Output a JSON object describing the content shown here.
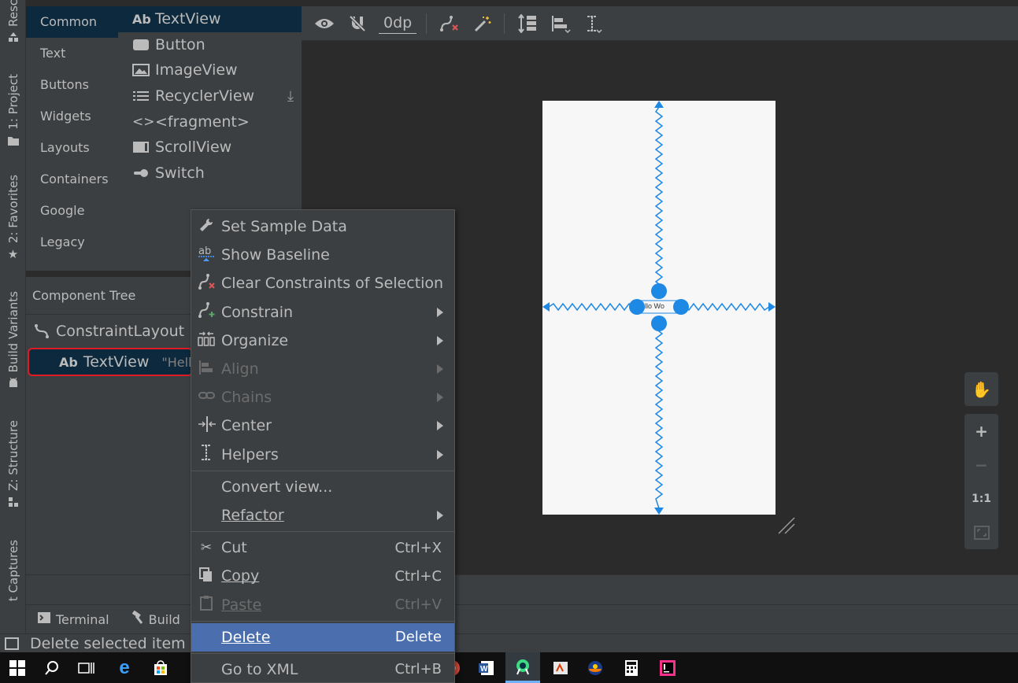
{
  "left_bar": {
    "tabs": [
      {
        "label": "Resc",
        "icon": "resource-manager-icon"
      },
      {
        "label": "1: Project",
        "icon": "folder-icon"
      },
      {
        "label": "2: Favorites",
        "icon": "star-icon"
      },
      {
        "label": "Build Variants",
        "icon": "android-icon"
      },
      {
        "label": "Z: Structure",
        "icon": "structure-icon"
      },
      {
        "label": "t Captures",
        "icon": "captures-icon"
      }
    ]
  },
  "palette": {
    "categories": [
      "Common",
      "Text",
      "Buttons",
      "Widgets",
      "Layouts",
      "Containers",
      "Google",
      "Legacy"
    ],
    "selected_category": "Common",
    "components": [
      {
        "label": "TextView",
        "icon": "Ab"
      },
      {
        "label": "Button",
        "icon": "button-icon"
      },
      {
        "label": "ImageView",
        "icon": "image-icon"
      },
      {
        "label": "RecyclerView",
        "icon": "list-icon"
      },
      {
        "label": "<fragment>",
        "icon": "code-icon"
      },
      {
        "label": "ScrollView",
        "icon": "scroll-icon"
      },
      {
        "label": "Switch",
        "icon": "switch-icon"
      }
    ]
  },
  "component_tree": {
    "title": "Component Tree",
    "root": "ConstraintLayout",
    "child": {
      "icon": "Ab",
      "label": "TextView",
      "text": "\"Hello"
    }
  },
  "toolbar": {
    "margin_value": "0dp"
  },
  "canvas": {
    "textview_text": "llo Wo"
  },
  "right_controls": {
    "zoom_fit_label": "1:1"
  },
  "bottom_tabs": [
    {
      "label": "Terminal",
      "icon": "terminal-icon"
    },
    {
      "label": "Build",
      "icon": "hammer-icon"
    }
  ],
  "status_bar": {
    "text": "Delete selected item"
  },
  "context_menu": {
    "items": [
      {
        "label": "Set Sample Data",
        "icon": "wrench-icon",
        "shortcut": "",
        "submenu": false,
        "disabled": false
      },
      {
        "label": "Show Baseline",
        "icon": "baseline-icon",
        "shortcut": "",
        "submenu": false,
        "disabled": false
      },
      {
        "label": "Clear Constraints of Selection",
        "icon": "clear-constraints-icon",
        "shortcut": "",
        "submenu": false,
        "disabled": false
      },
      {
        "label": "Constrain",
        "icon": "constrain-icon",
        "shortcut": "",
        "submenu": true,
        "disabled": false
      },
      {
        "label": "Organize",
        "icon": "organize-icon",
        "shortcut": "",
        "submenu": true,
        "disabled": false
      },
      {
        "label": "Align",
        "icon": "align-icon",
        "shortcut": "",
        "submenu": true,
        "disabled": true
      },
      {
        "label": "Chains",
        "icon": "chains-icon",
        "shortcut": "",
        "submenu": true,
        "disabled": true
      },
      {
        "label": "Center",
        "icon": "center-icon",
        "shortcut": "",
        "submenu": true,
        "disabled": false
      },
      {
        "label": "Helpers",
        "icon": "helpers-icon",
        "shortcut": "",
        "submenu": true,
        "disabled": false
      },
      {
        "label": "Convert view...",
        "icon": "",
        "shortcut": "",
        "submenu": false,
        "disabled": false
      },
      {
        "label": "Refactor",
        "icon": "",
        "shortcut": "",
        "submenu": true,
        "disabled": false
      },
      {
        "label": "Cut",
        "icon": "scissors-icon",
        "shortcut": "Ctrl+X",
        "submenu": false,
        "disabled": false
      },
      {
        "label": "Copy",
        "icon": "copy-icon",
        "shortcut": "Ctrl+C",
        "submenu": false,
        "disabled": false
      },
      {
        "label": "Paste",
        "icon": "paste-icon",
        "shortcut": "Ctrl+V",
        "submenu": false,
        "disabled": true
      },
      {
        "label": "Delete",
        "icon": "",
        "shortcut": "Delete",
        "submenu": false,
        "disabled": false,
        "highlighted": true
      },
      {
        "label": "Go to XML",
        "icon": "",
        "shortcut": "Ctrl+B",
        "submenu": false,
        "disabled": false
      }
    ]
  },
  "colors": {
    "ide_bg": "#2b2b2b",
    "panel_bg": "#3c3f41",
    "selection_bg": "#0d293e",
    "menu_highlight": "#4b6eaf",
    "constraint_blue": "#1e88e5",
    "tree_highlight_border": "#e01b24"
  }
}
